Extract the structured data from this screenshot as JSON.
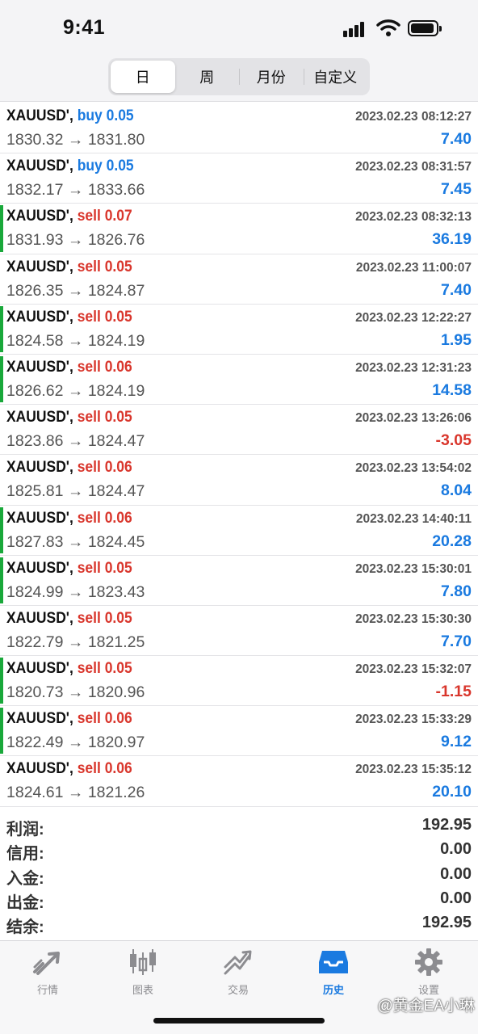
{
  "status_bar": {
    "time": "9:41"
  },
  "segments": [
    {
      "label": "日",
      "active": true
    },
    {
      "label": "周",
      "active": false
    },
    {
      "label": "月份",
      "active": false
    },
    {
      "label": "自定义",
      "active": false
    }
  ],
  "deals": [
    {
      "symbol": "XAUUSD',",
      "side": "buy",
      "lots": "0.05",
      "time": "2023.02.23 08:12:27",
      "prices": "1830.32 → 1831.80",
      "profit": "7.40",
      "bar": false
    },
    {
      "symbol": "XAUUSD',",
      "side": "buy",
      "lots": "0.05",
      "time": "2023.02.23 08:31:57",
      "prices": "1832.17 → 1833.66",
      "profit": "7.45",
      "bar": false
    },
    {
      "symbol": "XAUUSD',",
      "side": "sell",
      "lots": "0.07",
      "time": "2023.02.23 08:32:13",
      "prices": "1831.93 → 1826.76",
      "profit": "36.19",
      "bar": true
    },
    {
      "symbol": "XAUUSD',",
      "side": "sell",
      "lots": "0.05",
      "time": "2023.02.23 11:00:07",
      "prices": "1826.35 → 1824.87",
      "profit": "7.40",
      "bar": false
    },
    {
      "symbol": "XAUUSD',",
      "side": "sell",
      "lots": "0.05",
      "time": "2023.02.23 12:22:27",
      "prices": "1824.58 → 1824.19",
      "profit": "1.95",
      "bar": true
    },
    {
      "symbol": "XAUUSD',",
      "side": "sell",
      "lots": "0.06",
      "time": "2023.02.23 12:31:23",
      "prices": "1826.62 → 1824.19",
      "profit": "14.58",
      "bar": true
    },
    {
      "symbol": "XAUUSD',",
      "side": "sell",
      "lots": "0.05",
      "time": "2023.02.23 13:26:06",
      "prices": "1823.86 → 1824.47",
      "profit": "-3.05",
      "bar": false
    },
    {
      "symbol": "XAUUSD',",
      "side": "sell",
      "lots": "0.06",
      "time": "2023.02.23 13:54:02",
      "prices": "1825.81 → 1824.47",
      "profit": "8.04",
      "bar": false
    },
    {
      "symbol": "XAUUSD',",
      "side": "sell",
      "lots": "0.06",
      "time": "2023.02.23 14:40:11",
      "prices": "1827.83 → 1824.45",
      "profit": "20.28",
      "bar": true
    },
    {
      "symbol": "XAUUSD',",
      "side": "sell",
      "lots": "0.05",
      "time": "2023.02.23 15:30:01",
      "prices": "1824.99 → 1823.43",
      "profit": "7.80",
      "bar": true
    },
    {
      "symbol": "XAUUSD',",
      "side": "sell",
      "lots": "0.05",
      "time": "2023.02.23 15:30:30",
      "prices": "1822.79 → 1821.25",
      "profit": "7.70",
      "bar": false
    },
    {
      "symbol": "XAUUSD',",
      "side": "sell",
      "lots": "0.05",
      "time": "2023.02.23 15:32:07",
      "prices": "1820.73 → 1820.96",
      "profit": "-1.15",
      "bar": true
    },
    {
      "symbol": "XAUUSD',",
      "side": "sell",
      "lots": "0.06",
      "time": "2023.02.23 15:33:29",
      "prices": "1822.49 → 1820.97",
      "profit": "9.12",
      "bar": true
    },
    {
      "symbol": "XAUUSD',",
      "side": "sell",
      "lots": "0.06",
      "time": "2023.02.23 15:35:12",
      "prices": "1824.61 → 1821.26",
      "profit": "20.10",
      "bar": false
    }
  ],
  "summary": [
    {
      "label": "利润:",
      "value": "192.95"
    },
    {
      "label": "信用:",
      "value": "0.00"
    },
    {
      "label": "入金:",
      "value": "0.00"
    },
    {
      "label": "出金:",
      "value": "0.00"
    },
    {
      "label": "结余:",
      "value": "192.95"
    }
  ],
  "tabbar": [
    {
      "label": "行情",
      "icon": "quotes-icon",
      "active": false
    },
    {
      "label": "图表",
      "icon": "chart-icon",
      "active": false
    },
    {
      "label": "交易",
      "icon": "trade-icon",
      "active": false
    },
    {
      "label": "历史",
      "icon": "history-icon",
      "active": true
    },
    {
      "label": "设置",
      "icon": "settings-icon",
      "active": false
    }
  ],
  "watermark": "@黄金EA小琳",
  "colors": {
    "buy": "#1a7ae0",
    "sell": "#d9362c",
    "profit_positive": "#1a7ae0",
    "profit_negative": "#d9362c",
    "bar": "#19a83a",
    "tab_active": "#1a7ae0"
  }
}
